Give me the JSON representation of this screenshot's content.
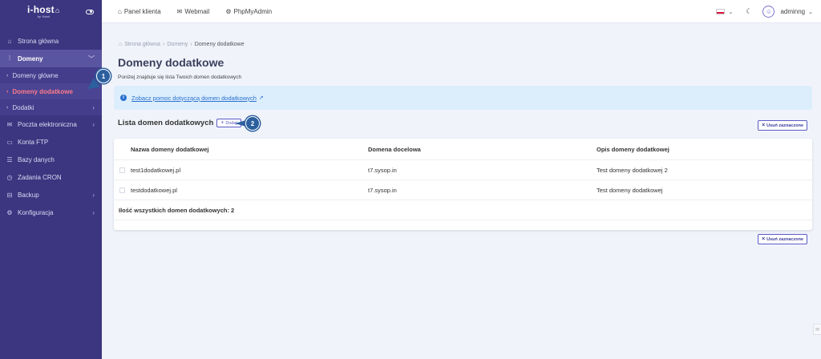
{
  "brand": {
    "logo": "i-host",
    "tagline": "by Yolad"
  },
  "topbar": {
    "links": [
      {
        "icon": "home-icon",
        "label": "Panel klienta"
      },
      {
        "icon": "mail-icon",
        "label": "Webmail"
      },
      {
        "icon": "gear-icon",
        "label": "PhpMyAdmin"
      }
    ],
    "language": "pl",
    "user": "adminng"
  },
  "sidebar": {
    "items": [
      {
        "icon": "home-icon",
        "label": "Strona główna"
      },
      {
        "icon": "bars-icon",
        "label": "Domeny",
        "active": true
      },
      {
        "icon": "mail-icon",
        "label": "Poczta elektroniczna"
      },
      {
        "icon": "folder-icon",
        "label": "Konta FTP"
      },
      {
        "icon": "database-icon",
        "label": "Bazy danych"
      },
      {
        "icon": "clock-icon",
        "label": "Zadania CRON"
      },
      {
        "icon": "backup-icon",
        "label": "Backup"
      },
      {
        "icon": "gear-icon",
        "label": "Konfiguracja"
      }
    ],
    "sub_items": [
      {
        "label": "Domeny główne"
      },
      {
        "label": "Domeny dodatkowe",
        "current": true
      },
      {
        "label": "Dodatki"
      }
    ]
  },
  "breadcrumb": {
    "home": "Strona główna",
    "section": "Domeny",
    "current": "Domeny dodatkowe"
  },
  "page": {
    "title": "Domeny dodatkowe",
    "subtitle": "Poniżej znajduje się lista Twoich domen dodatkowych",
    "help_link": "Zobacz pomoc dotyczącą domen dodatkowych"
  },
  "list": {
    "title": "Lista domen dodatkowych",
    "add_label": "Dodaj",
    "delete_selected_label": "Usuń zaznaczone",
    "columns": [
      "Nazwa domeny dodatkowej",
      "Domena docelowa",
      "Opis domeny dodatkowej"
    ],
    "rows": [
      [
        "test1dodatkowej.pl",
        "t7.sysop.in",
        "Test domeny dodatkowej 2"
      ],
      [
        "testdodatkowej.pl",
        "t7.sysop.in",
        "Test domeny dodatkowej"
      ]
    ],
    "footer": "Ilość wszystkich domen dodatkowych: 2"
  },
  "callouts": [
    "1",
    "2"
  ],
  "colors": {
    "sidebar": "#3c3680",
    "accent": "#5b5ac6",
    "current_nav": "#ff7b8a",
    "callout": "#2c5f9e",
    "info_bg": "#dceefb"
  }
}
